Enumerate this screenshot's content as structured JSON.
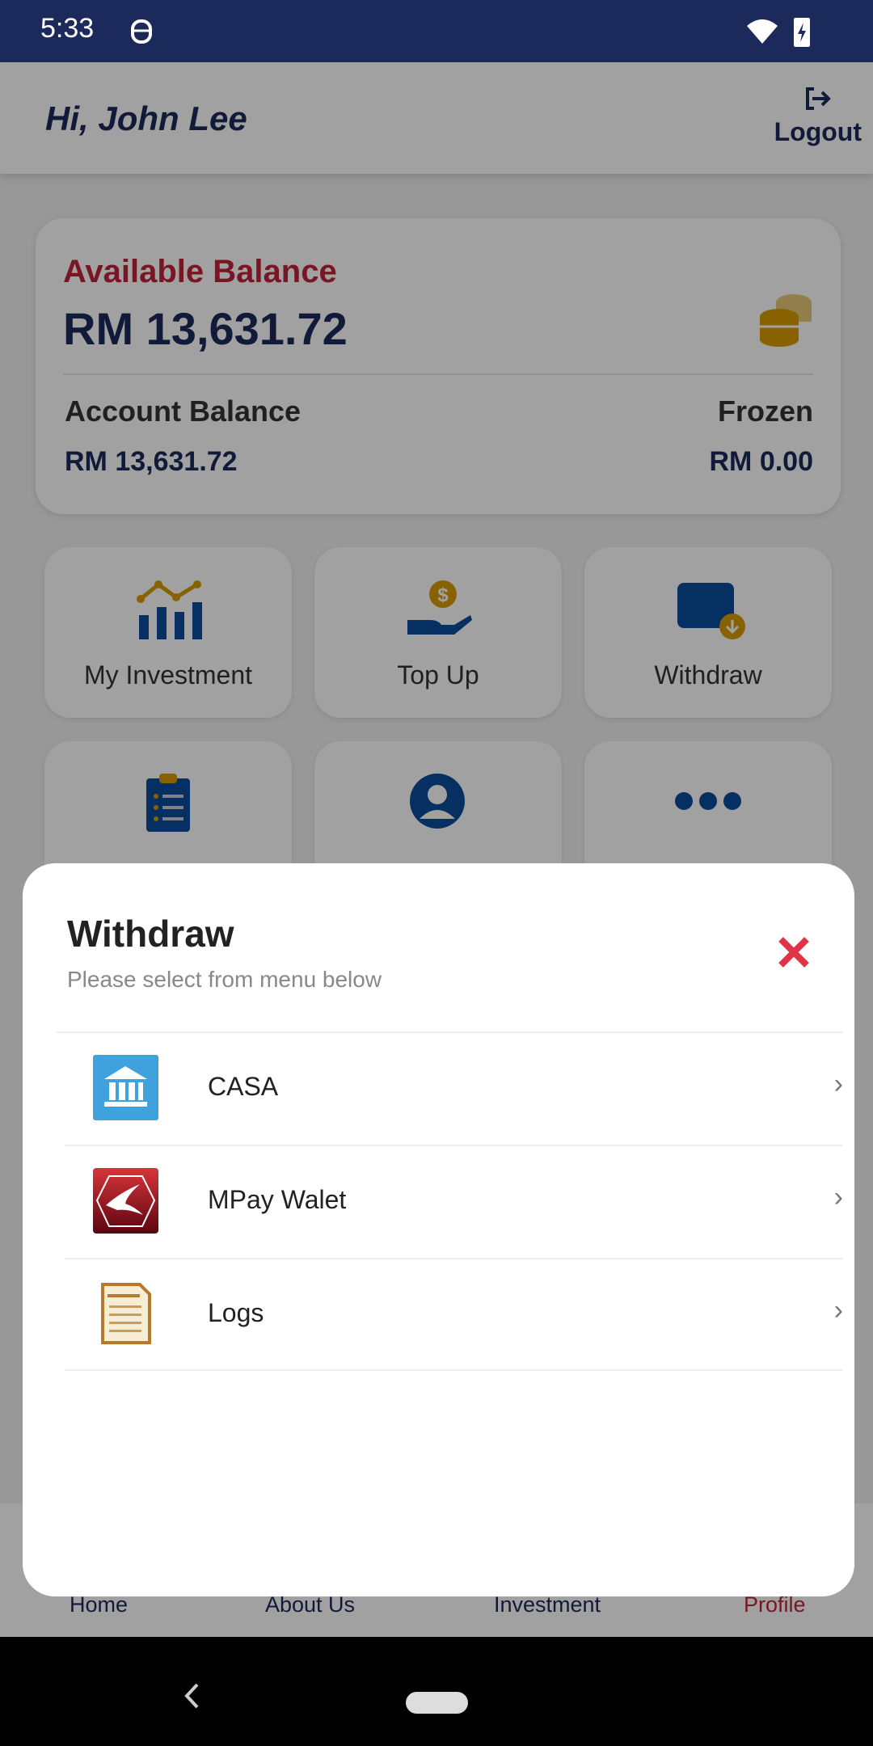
{
  "status_bar": {
    "time": "5:33"
  },
  "header": {
    "greeting": "Hi, John Lee",
    "logout_label": "Logout"
  },
  "balance": {
    "available_label": "Available Balance",
    "available_value": "RM 13,631.72",
    "account_label": "Account Balance",
    "account_value": "RM 13,631.72",
    "frozen_label": "Frozen",
    "frozen_value": "RM 0.00"
  },
  "tiles": [
    {
      "label": "My Investment",
      "icon": "chart-icon"
    },
    {
      "label": "Top Up",
      "icon": "hand-coin-icon"
    },
    {
      "label": "Withdraw",
      "icon": "wallet-icon"
    },
    {
      "icon": "clipboard-icon"
    },
    {
      "icon": "user-circle-icon"
    },
    {
      "icon": "more-icon"
    }
  ],
  "bottom_nav": [
    {
      "label": "Home"
    },
    {
      "label": "About Us"
    },
    {
      "label": "Investment"
    },
    {
      "label": "Profile",
      "active": true
    }
  ],
  "sheet": {
    "title": "Withdraw",
    "subtitle": "Please select from menu below",
    "items": [
      {
        "label": "CASA",
        "icon": "bank-icon"
      },
      {
        "label": "MPay Walet",
        "icon": "mpay-logo-icon"
      },
      {
        "label": "Logs",
        "icon": "notepad-icon"
      }
    ]
  },
  "colors": {
    "navy": "#1b2a5a",
    "accent_red": "#c0243a",
    "close_red": "#e03446",
    "gold": "#d89b00",
    "icon_blue": "#0a4c9a"
  }
}
